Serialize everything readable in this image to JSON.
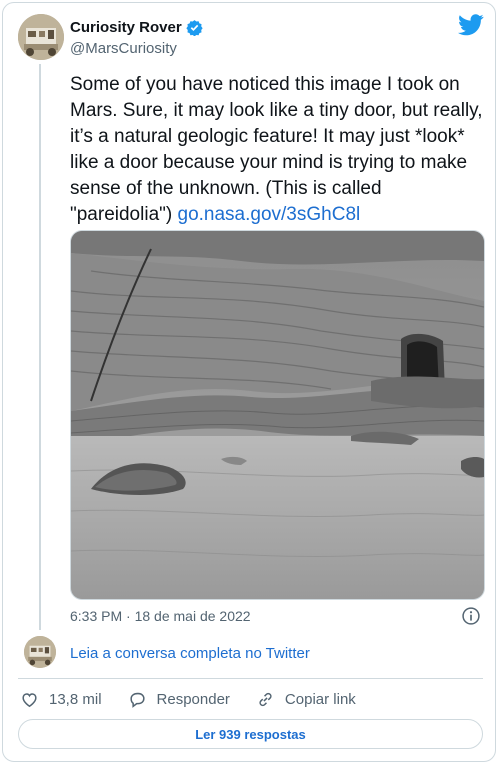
{
  "author": {
    "name": "Curiosity Rover",
    "handle": "@MarsCuriosity",
    "verified": true
  },
  "tweet": {
    "text_main": "Some of you have noticed this image I took on Mars. Sure, it may look like a tiny door, but really, it’s a natural geologic feature! It may just *look* like a door because your mind is trying to make sense of the unknown. (This is called \"pareidolia\")",
    "link": "go.nasa.gov/3sGhC8l",
    "timestamp": "6:33 PM · 18 de mai de 2022"
  },
  "thread": {
    "read_more": "Leia a conversa completa no Twitter"
  },
  "actions": {
    "like_count": "13,8 mil",
    "reply_label": "Responder",
    "copy_label": "Copiar link"
  },
  "footer": {
    "read_replies": "Ler 939 respostas"
  },
  "colors": {
    "link": "#1d6ed0",
    "twitter_blue": "#1d9bf0",
    "muted": "#536471",
    "border": "#cfd9de"
  },
  "icons": [
    "verified-badge-icon",
    "twitter-bird-icon",
    "info-icon",
    "heart-icon",
    "reply-icon",
    "link-icon"
  ]
}
